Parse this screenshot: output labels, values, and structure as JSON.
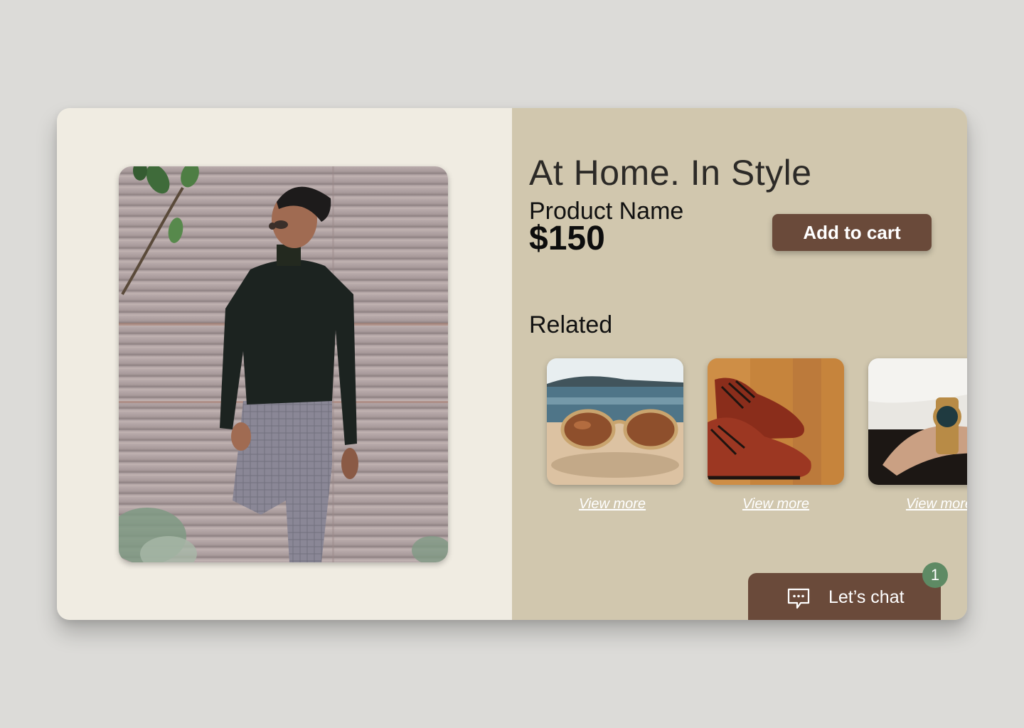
{
  "hero": {
    "image_subject": "man in black turtleneck and plaid trousers leaning on a metal shutter"
  },
  "product": {
    "tagline": "At Home. In Style",
    "name": "Product Name",
    "price": "$150",
    "add_to_cart_label": "Add to cart"
  },
  "related": {
    "title": "Related",
    "items": [
      {
        "image": "sunglasses",
        "link_label": "View more"
      },
      {
        "image": "brown leather shoes",
        "link_label": "View more"
      },
      {
        "image": "wristwatch",
        "link_label": "View more"
      }
    ]
  },
  "chat": {
    "label": "Let’s chat",
    "icon": "chat-bubble-icon",
    "badge_count": "1"
  },
  "colors": {
    "page_bg": "#dcdbd8",
    "left_panel": "#f0ece2",
    "right_panel": "#d1c7ae",
    "accent_brown": "#6a4a3a",
    "badge_green": "#5e8a64"
  }
}
